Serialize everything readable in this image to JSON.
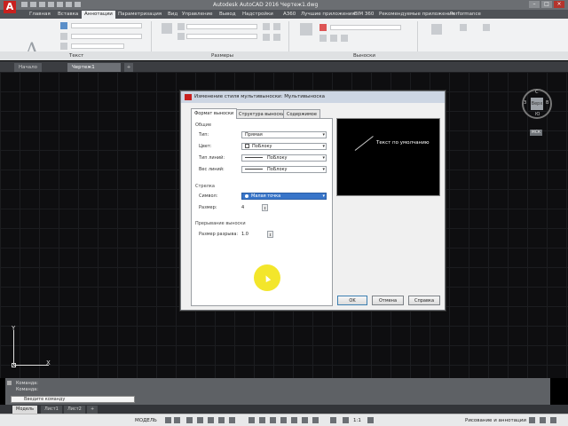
{
  "window": {
    "title": "Autodesk AutoCAD 2016  Чертеж1.dwg",
    "logo": "A",
    "controls": [
      "–",
      "□",
      "×"
    ]
  },
  "menu_tabs": [
    "Главная",
    "Вставка",
    "Аннотации",
    "Параметризация",
    "Вид",
    "Управление",
    "Вывод",
    "Надстройки",
    "A360",
    "Лучшие приложения",
    "BIM 360",
    "Рекомендуемые приложения",
    "Performance"
  ],
  "menu_active_index": 2,
  "ribbon": {
    "panels": [
      "Текст",
      "Размеры",
      "Выноски"
    ]
  },
  "file_tabs": [
    "Начало",
    "Чертеж1",
    "+"
  ],
  "file_active_index": 1,
  "viewcube": {
    "face": "Верх",
    "north": "С",
    "south": "Ю",
    "west": "З",
    "east": "В",
    "wcs": "МСК"
  },
  "ucs": {
    "x": "X",
    "y": "Y"
  },
  "dialog": {
    "title": "Изменение стиля мультивыноски: Мультивыноска",
    "tabs": [
      "Формат выноски",
      "Структура выноски",
      "Содержимое"
    ],
    "active_tab": 0,
    "general": {
      "heading": "Общие",
      "type_label": "Тип:",
      "type_value": "Прямая",
      "color_label": "Цвет:",
      "color_value": "ПоБлоку",
      "linetype_label": "Тип линий:",
      "linetype_value": "ПоБлоку",
      "lineweight_label": "Вес линий:",
      "lineweight_value": "ПоБлоку"
    },
    "arrow": {
      "heading": "Стрелка",
      "symbol_label": "Символ:",
      "symbol_value": "Малая точка",
      "size_label": "Размер:",
      "size_value": "4"
    },
    "break": {
      "heading": "Прерывание выноски",
      "size_label": "Размер разрыва:",
      "size_value": "1.0"
    },
    "preview_text": "Текст по умолчанию",
    "buttons": [
      "OK",
      "Отмена",
      "Справка"
    ]
  },
  "command_line": {
    "history": [
      "Команда:",
      "Команда:"
    ],
    "input_placeholder": "Введите команду"
  },
  "layout_tabs": [
    "Модель",
    "Лист1",
    "Лист2",
    "+"
  ],
  "layout_active_index": 0,
  "status": {
    "model": "МОДЕЛЬ",
    "annotation_scale": "1:1",
    "workspace": "Рисование и аннотации"
  }
}
